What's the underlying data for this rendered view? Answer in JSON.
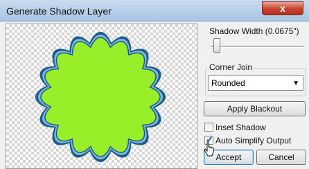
{
  "window": {
    "title": "Generate Shadow Layer",
    "close_label": "x"
  },
  "shadow_width": {
    "label": "Shadow Width (0.0675\")",
    "value_fraction": 0.07
  },
  "corner_join": {
    "group_label": "Corner Join",
    "selected": "Rounded"
  },
  "buttons": {
    "apply_blackout": "Apply Blackout",
    "accept": "Accept",
    "cancel": "Cancel"
  },
  "options": {
    "inset_shadow": {
      "label": "Inset Shadow",
      "checked": false
    },
    "auto_simplify": {
      "label": "Auto Simplify Output",
      "checked": true
    }
  },
  "colors": {
    "shape_fill": "#99ee2a",
    "shadow_outline": "#1b5d86",
    "shadow_inner": "#7fb7e3"
  },
  "preview": {
    "shape": "scalloped-circle",
    "scallops": 16
  }
}
